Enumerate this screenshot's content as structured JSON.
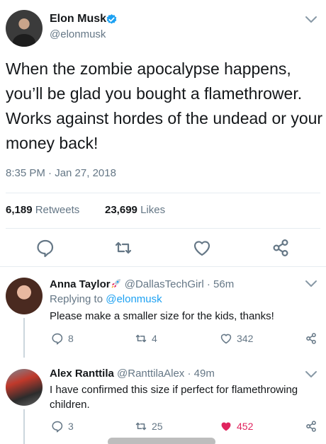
{
  "tweet": {
    "author_name": "Elon Musk",
    "author_handle": "@elonmusk",
    "text": "When the zombie apocalypse happens, you’ll be glad you bought a flamethrower. Works against hordes of the undead or your money back!",
    "timestamp": "8:35 PM · Jan 27, 2018",
    "retweets_count": "6,189",
    "retweets_label": "Retweets",
    "likes_count": "23,699",
    "likes_label": "Likes",
    "verified": true
  },
  "replies": [
    {
      "author_name": "Anna Taylor",
      "author_handle": "@DallasTechGirl",
      "time_ago": "56m",
      "replying_prefix": "Replying to",
      "replying_handle": "@elonmusk",
      "text": "Please make a smaller size for the kids, thanks!",
      "reply_count": "8",
      "retweet_count": "4",
      "like_count": "342",
      "liked": false
    },
    {
      "author_name": "Alex Ranttila",
      "author_handle": "@RanttilaAlex",
      "time_ago": "49m",
      "text": "I have confirmed this size if perfect for flamethrowing children.",
      "reply_count": "3",
      "retweet_count": "25",
      "like_count": "452",
      "liked": true
    }
  ],
  "colors": {
    "accent": "#1da1f2",
    "secondary_text": "#657786",
    "like_active": "#e0245e",
    "divider": "#e6ecf0"
  },
  "icons": {
    "verified": "verified-badge-icon",
    "chevron": "chevron-down-icon",
    "reply": "reply-icon",
    "retweet": "retweet-icon",
    "like": "heart-icon",
    "share": "share-icon",
    "emoji": "rocket-emoji-icon"
  }
}
